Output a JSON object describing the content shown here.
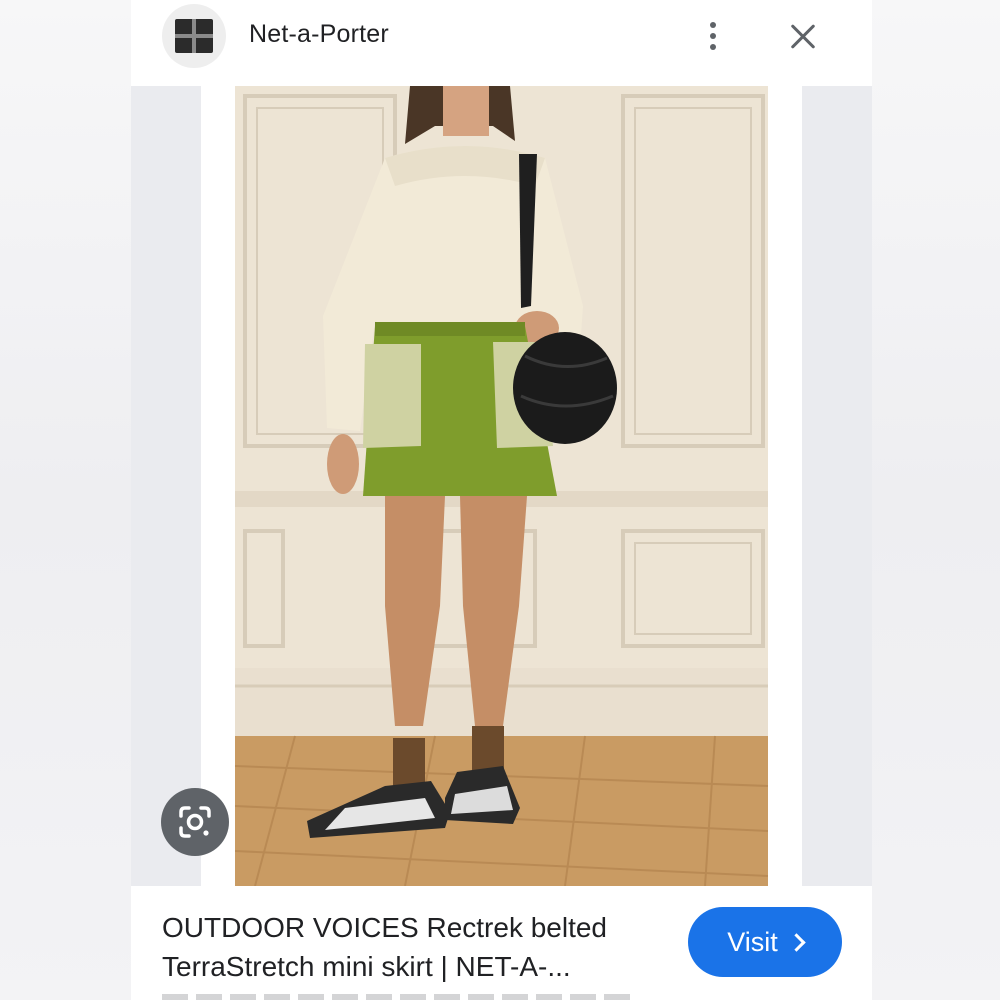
{
  "header": {
    "site_name": "Net-a-Porter",
    "logo_icon": "gift-box-icon",
    "more_icon": "more-vert-icon",
    "close_icon": "close-icon"
  },
  "image": {
    "lens_icon": "google-lens-icon"
  },
  "result": {
    "title_line1": "OUTDOOR VOICES Rectrek belted",
    "title_line2": "TerraStretch mini skirt | NET-A-...",
    "visit_label": "Visit",
    "visit_icon": "chevron-right-icon"
  },
  "colors": {
    "accent": "#1a73e8",
    "text": "#202124",
    "icon": "#5f6368"
  }
}
